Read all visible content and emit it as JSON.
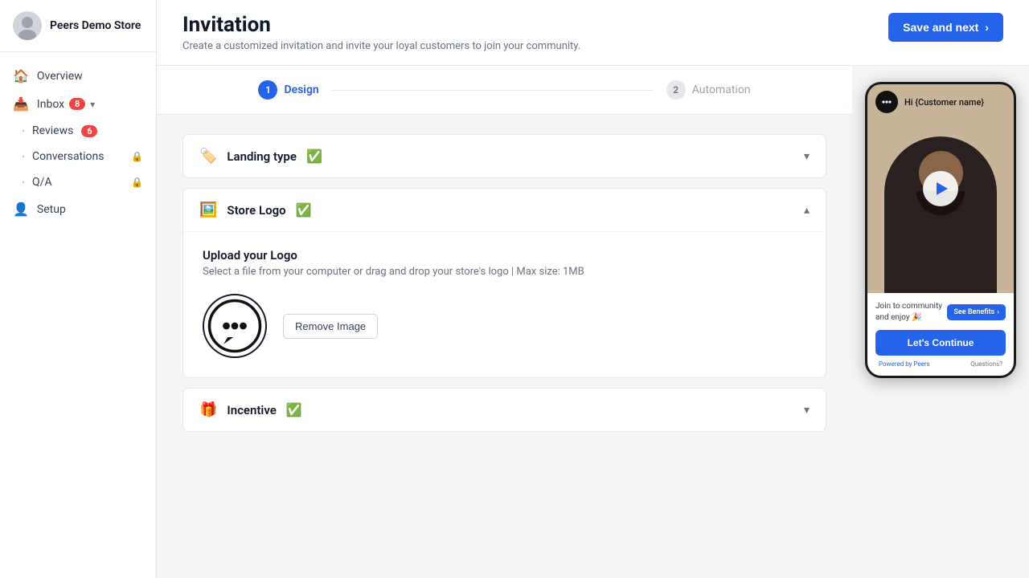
{
  "sidebar": {
    "store_name": "Peers Demo Store",
    "nav_items": [
      {
        "id": "overview",
        "label": "Overview",
        "icon": "🏠",
        "badge": null,
        "locked": false,
        "has_dropdown": false
      },
      {
        "id": "inbox",
        "label": "Inbox",
        "icon": "📥",
        "badge": "8",
        "locked": false,
        "has_dropdown": true
      },
      {
        "id": "reviews",
        "label": "Reviews",
        "icon": null,
        "badge": "6",
        "locked": false,
        "has_dropdown": false,
        "is_sub": true
      },
      {
        "id": "conversations",
        "label": "Conversations",
        "icon": null,
        "badge": null,
        "locked": true,
        "has_dropdown": false,
        "is_sub": true
      },
      {
        "id": "qa",
        "label": "Q/A",
        "icon": null,
        "badge": null,
        "locked": true,
        "has_dropdown": false,
        "is_sub": true
      },
      {
        "id": "setup",
        "label": "Setup",
        "icon": "👤",
        "badge": null,
        "locked": false,
        "has_dropdown": false
      }
    ]
  },
  "header": {
    "page_title": "Invitation",
    "page_subtitle": "Create a customized invitation and invite your loyal customers to join your community.",
    "save_next_label": "Save and next",
    "save_next_arrow": "›"
  },
  "stepper": {
    "steps": [
      {
        "id": "design",
        "number": "1",
        "label": "Design",
        "active": true
      },
      {
        "id": "automation",
        "number": "2",
        "label": "Automation",
        "active": false
      }
    ]
  },
  "sections": [
    {
      "id": "landing-type",
      "icon": "🏷",
      "title": "Landing type",
      "checked": true,
      "expanded": false
    },
    {
      "id": "store-logo",
      "icon": "🖼",
      "title": "Store Logo",
      "checked": true,
      "expanded": true,
      "body": {
        "upload_title": "Upload your Logo",
        "upload_subtitle": "Select a file from your computer or drag and drop your store's logo | Max size: 1MB",
        "remove_button_label": "Remove Image"
      }
    },
    {
      "id": "incentive",
      "icon": "🎁",
      "title": "Incentive",
      "checked": true,
      "expanded": false
    }
  ],
  "phone_preview": {
    "greeting": "Hi {Customer name}",
    "join_text": "Join to community and enjoy 🎉",
    "see_benefits_label": "See Benefits",
    "lets_continue_label": "Let's Continue",
    "powered_by_label": "Powered by",
    "powered_by_brand": "Peers",
    "questions_label": "Questions?"
  }
}
